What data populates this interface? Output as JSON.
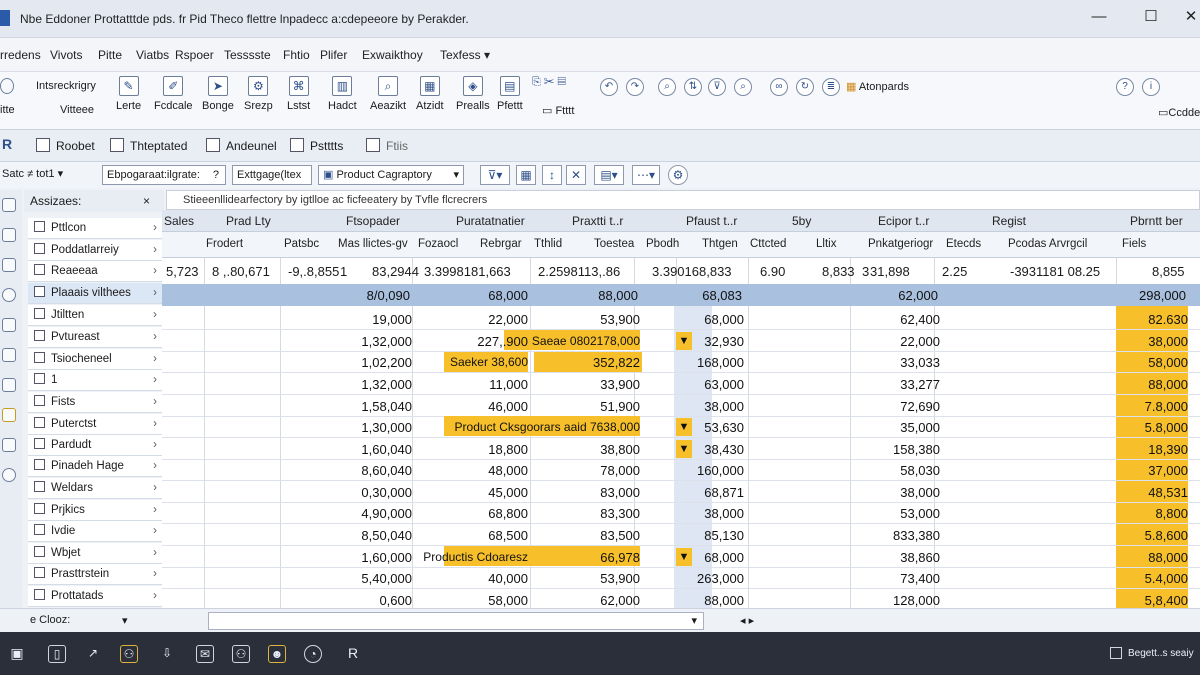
{
  "window": {
    "title": "Nbe Eddoner Prottatttde pds. fr Pid Theco flettre lnpadecc a:cdepeeore by Perakder.",
    "minimize": "—",
    "maximize": "☐",
    "close": "✕"
  },
  "menu": [
    "rredens",
    "Vivots",
    "Pitte",
    "Viatbs",
    "Rspoer",
    "Tesssste",
    "Fhtio",
    "Plifer",
    "Exwaikthoy",
    "Texfess ▾"
  ],
  "ribbon": {
    "group1": [
      "Intsreckrigry",
      "Vitteee"
    ],
    "buttons": [
      "Lerte",
      "Fcdcale",
      "Bonge",
      "Srezp",
      "Lstst",
      "Hadct",
      "Aeazikt",
      "Atzidt",
      "Prealls",
      "Pfettt"
    ],
    "extra_label": "Ftttt",
    "right_label": "Atonpards",
    "far_right": "Ccdde"
  },
  "subtabs": [
    "Roobet",
    "Thteptated",
    "Andeunel",
    "Pstttts",
    "Ftiis"
  ],
  "filterbar": {
    "left_label": "Satc ≠ tot1 ▾",
    "dd1": "Ebpogaraat:ilgrate:",
    "dd1_q": "?",
    "dd2": "Exttgage(ltex",
    "dd3": "Product Cagraptory"
  },
  "formula": "Stieeenllidearfectory by igtlloe ac ficfeeatery by Tvfle flcrecrers",
  "nav": {
    "title": "Assizaes:",
    "close": "×",
    "items": [
      "Pttlcon",
      "Poddatlarreiy",
      "Reaeeaa",
      "Plaaais vilthees",
      "Jtiltten",
      "Pvtureast",
      "Tsiocheneel",
      "1",
      "Fists",
      "Puterctst",
      "Pardudt",
      "Pinadeh Hage",
      "Weldars",
      "Prjkics",
      "Ivdie",
      "Wbjet",
      "Prasttrstein",
      "Prottatads"
    ]
  },
  "grid": {
    "header_top": [
      "Sales",
      "Prad Lty",
      "Ftsopader",
      "Puratatnatier",
      "Praxtti t..r",
      "Pfaust t..r",
      "5by",
      "Ecipor t..r",
      "Regist",
      "Pbrntt ber"
    ],
    "header_sub": [
      "Frodert",
      "Patsbc",
      "Mas llictes-gv",
      "Fozaocl",
      "Rebrgar",
      "Tthlid",
      "Toestea",
      "Pbodh",
      "Thtgen",
      "Cttcted",
      "Lltix",
      "Pnkatgeriogr",
      "Etecds",
      "Pcodas Arvrgcil",
      "Fiels"
    ],
    "row_top": [
      "5,723",
      "8 ,.80,671",
      "-9,.8,855",
      "1",
      "83,2944",
      "3.3998181,663",
      "2.2598113,.86",
      "3.390168,833",
      "6.90",
      "8,833",
      "3",
      "31,898",
      "2.25",
      "-3931181 08.25",
      "8,855"
    ],
    "band": [
      "8/0,090",
      "68,000",
      "88,000",
      "68,083",
      "62,000",
      "298,000"
    ],
    "colA": [
      "19,000",
      "1,32,000",
      "1,02,200",
      "1,32,000",
      "1,58,040",
      "1,30,000",
      "1,60,040",
      "8,60,040",
      "0,30,000",
      "4,90,000",
      "8,50,040",
      "1,60,000",
      "5,40,000",
      "0,600"
    ],
    "colB": [
      "22,000",
      "227,.900",
      "Saeker 38,600",
      "11,000",
      "46,000",
      "",
      "18,800",
      "48,000",
      "45,000",
      "68,800",
      "68,500",
      "Productis Cdoaresz",
      "40,000",
      "58,000"
    ],
    "colC": [
      "53,900",
      "Saeae 0802178,000",
      "352,822",
      "33,900",
      "51,900",
      "Product Cksgoorars aaid 7638,000",
      "38,800",
      "78,000",
      "83,000",
      "83,300",
      "83,500",
      "66,978",
      "53,900",
      "62,000"
    ],
    "colD": [
      "68,000",
      "32,930",
      "168,000",
      "63,000",
      "38,000",
      "53,630",
      "38,430",
      "160,000",
      "68,871",
      "38,000",
      "85,130",
      "68,000",
      "263,000",
      "88,000"
    ],
    "colE": [
      "62,400",
      "22,000",
      "33,033",
      "33,277",
      "72,690",
      "35,000",
      "158,380",
      "58,030",
      "38,000",
      "53,000",
      "833,380",
      "38,860",
      "73,400",
      "128,000"
    ],
    "colF": [
      "82.630",
      "38,000",
      "58,000",
      "88,000",
      "7.8,000",
      "5.8,000",
      "18,390",
      "37,000",
      "48,531",
      "8,800",
      "5.8,600",
      "88,000",
      "5.4,000",
      "5,8,400"
    ]
  },
  "statusbar": {
    "label": "e Clooz:",
    "dropdown": ""
  },
  "taskbar": {
    "right": "Begett..s seaiy"
  }
}
